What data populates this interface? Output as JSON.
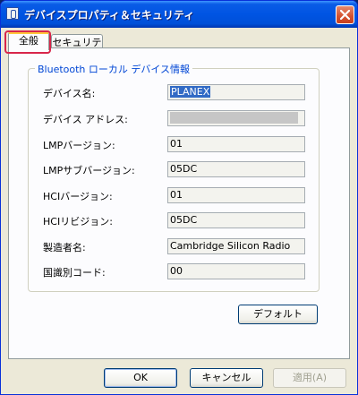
{
  "window": {
    "title": "デバイスプロパティ＆セキュリティ"
  },
  "tabs": [
    {
      "label": "全般",
      "active": true
    },
    {
      "label": "セキュリティ",
      "active": false
    }
  ],
  "group": {
    "legend": "Bluetooth ローカル デバイス情報",
    "rows": [
      {
        "label": "デバイス名:",
        "value": "PLANEX"
      },
      {
        "label": "デバイス アドレス:",
        "value": "■■:■■:■■:■■:■■:■■"
      },
      {
        "label": "LMPバージョン:",
        "value": "01"
      },
      {
        "label": "LMPサブバージョン:",
        "value": "05DC"
      },
      {
        "label": "HCIバージョン:",
        "value": "01"
      },
      {
        "label": "HCIリビジョン:",
        "value": "05DC"
      },
      {
        "label": "製造者名:",
        "value": "Cambridge Silicon Radio"
      },
      {
        "label": "国識別コード:",
        "value": "00"
      }
    ]
  },
  "buttons": {
    "default": "デフォルト",
    "ok": "OK",
    "cancel": "キャンセル",
    "apply": "適用(A)"
  },
  "colors": {
    "highlight": "#d8264a",
    "legend": "#0046d5",
    "titlebar": "#0054e3"
  }
}
